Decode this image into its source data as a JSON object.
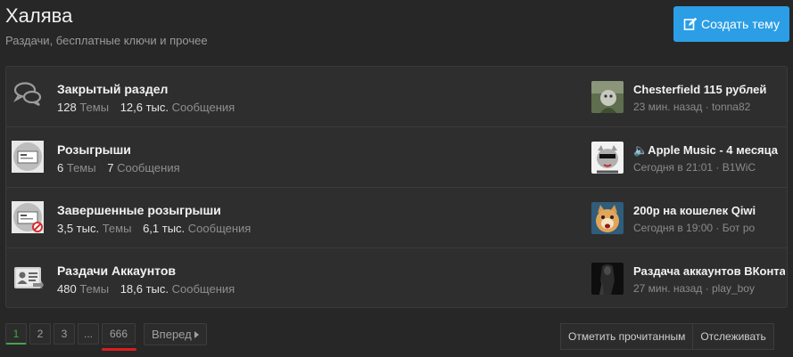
{
  "header": {
    "title": "Халява",
    "description": "Раздачи, бесплатные ключи и прочее",
    "create_button": "Создать тему"
  },
  "nodes": [
    {
      "icon": "speech-bubbles-icon",
      "title": "Закрытый раздел",
      "threads_count": "128",
      "threads_label": "Темы",
      "messages_count": "12,6 тыс.",
      "messages_label": "Сообщения",
      "last_title": "Chesterfield 115 рублей",
      "last_meta": "23 мин. назад · tonna82"
    },
    {
      "icon": "giveaway-ticket-icon",
      "title": "Розыгрыши",
      "threads_count": "6",
      "threads_label": "Темы",
      "messages_count": "7",
      "messages_label": "Сообщения",
      "last_title": "🔈Apple Music - 4 месяца",
      "last_meta": "Сегодня в 21:01 · B1WiC"
    },
    {
      "icon": "giveaway-ended-icon",
      "title": "Завершенные розыгрыши",
      "threads_count": "3,5 тыс.",
      "threads_label": "Темы",
      "messages_count": "6,1 тыс.",
      "messages_label": "Сообщения",
      "last_title": "200р на кошелек Qiwi",
      "last_meta": "Сегодня в 19:00 · Бот ро"
    },
    {
      "icon": "account-card-icon",
      "title": "Раздачи Аккаунтов",
      "threads_count": "480",
      "threads_label": "Темы",
      "messages_count": "18,6 тыс.",
      "messages_label": "Сообщения",
      "last_title": "Раздача аккаунтов ВКонтакте",
      "last_meta": "27 мин. назад · play_boy"
    }
  ],
  "pager": {
    "pages": [
      "1",
      "2",
      "3",
      "...",
      "666"
    ],
    "current": "1",
    "next_label": "Вперед"
  },
  "actions": {
    "mark_read": "Отметить прочитанным",
    "watch": "Отслеживать"
  },
  "colors": {
    "accent": "#2b9ee6",
    "current_page": "#4aa34a",
    "highlight_underline": "#d81e1e"
  }
}
